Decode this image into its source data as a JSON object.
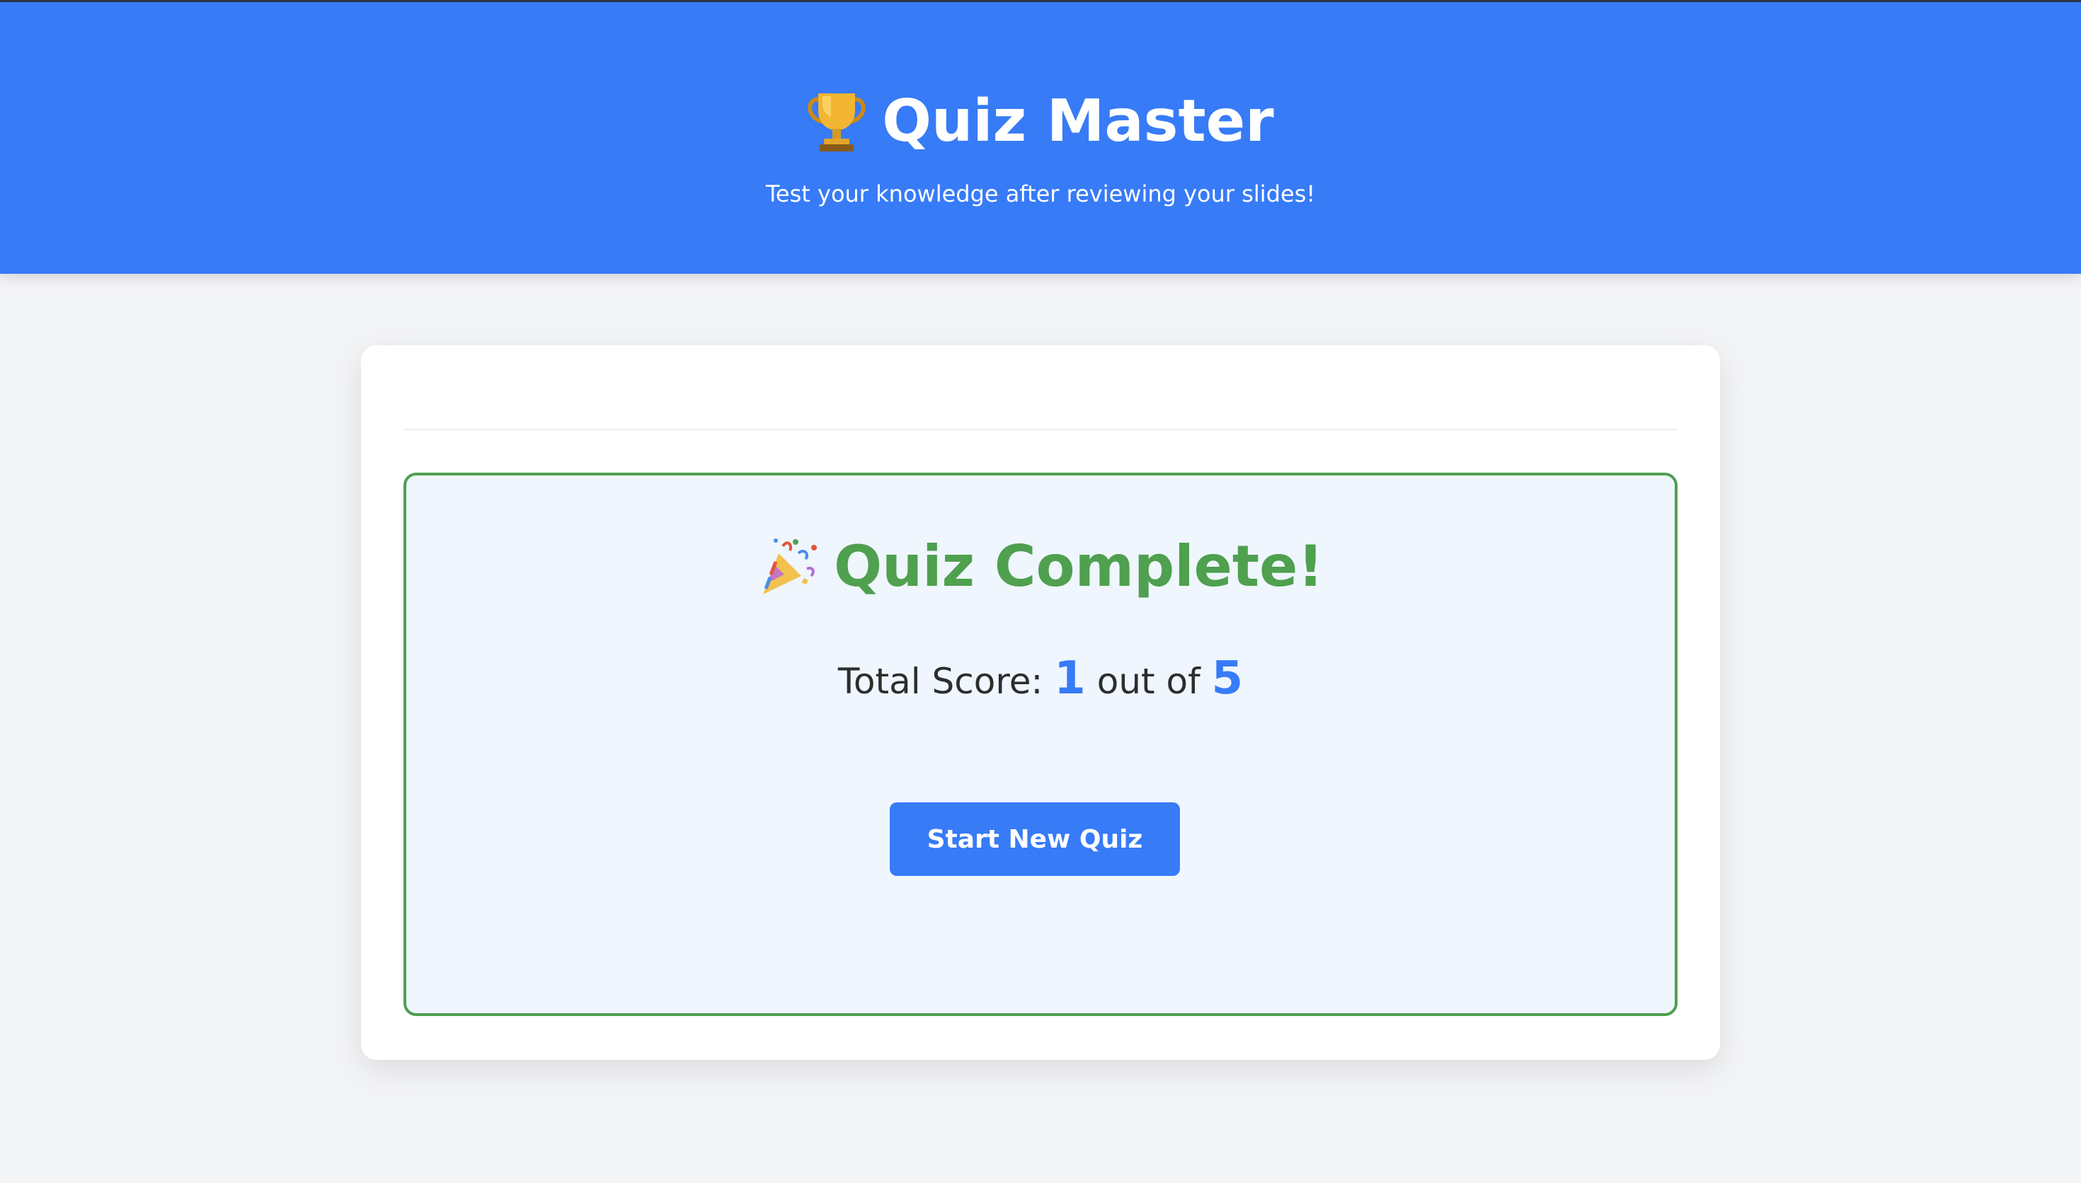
{
  "header": {
    "title": "Quiz Master",
    "title_icon": "trophy-icon",
    "subtitle": "Test your knowledge after reviewing your slides!"
  },
  "result": {
    "title": "Quiz Complete!",
    "title_icon": "party-popper-icon",
    "score_label": "Total Score:",
    "score": "1",
    "out_of_label": "out of",
    "total": "5",
    "button_label": "Start New Quiz"
  },
  "colors": {
    "header_bg": "#377bf7",
    "accent_blue": "#377bf7",
    "success_green": "#4fa04f",
    "panel_bg": "#eff6fe",
    "page_bg": "#f3f4f6"
  }
}
